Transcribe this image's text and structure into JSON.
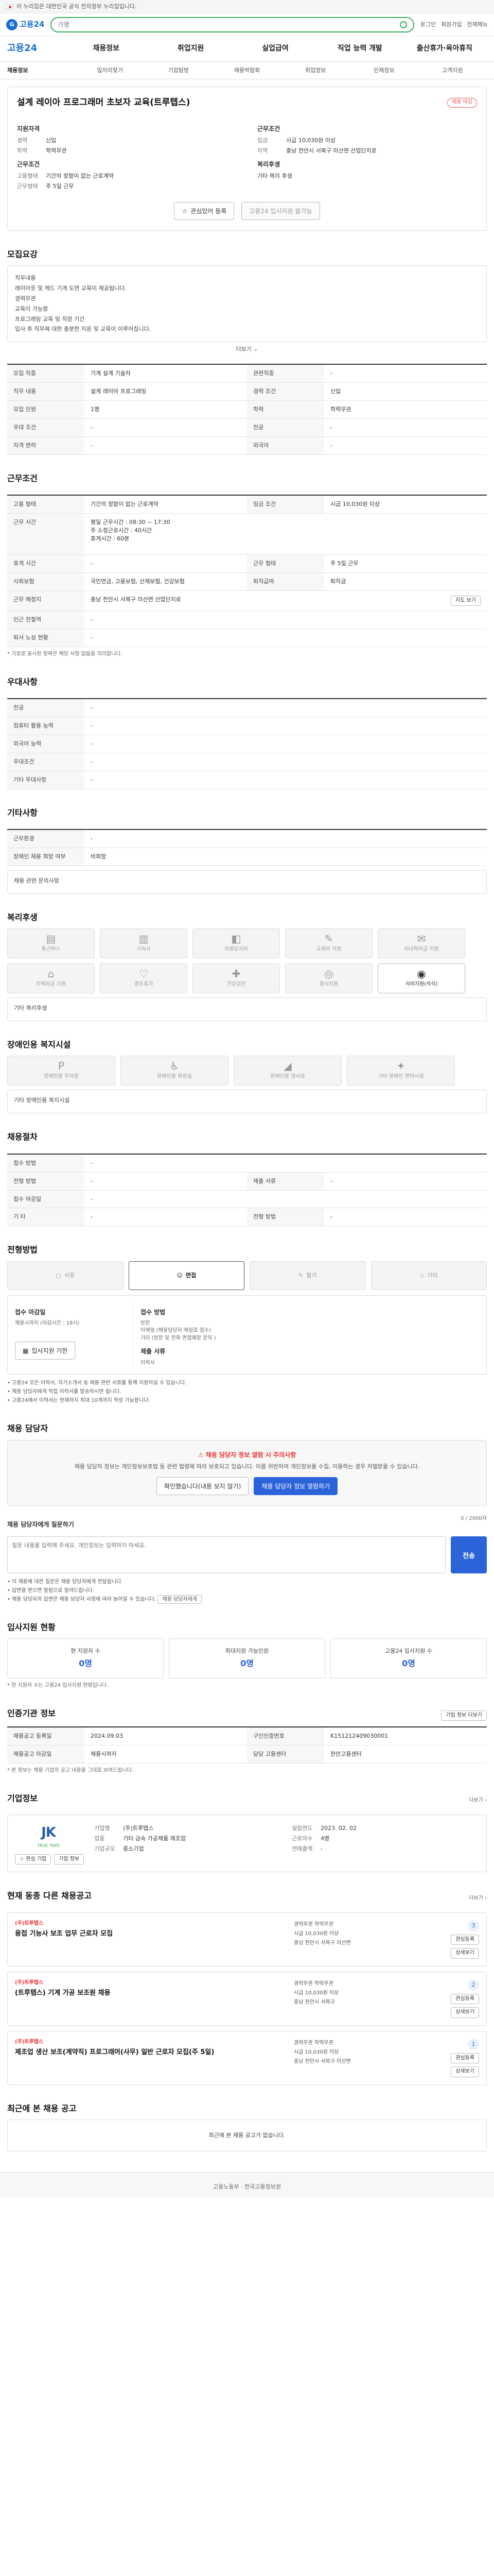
{
  "banner": {
    "text": "이 누리집은 대한민국 공식 전자정부 누리집입니다."
  },
  "topbar": {
    "logo": "고용24",
    "search_placeholder": "가맹",
    "links": [
      "로그인",
      "회원가입",
      "전체메뉴"
    ]
  },
  "gnb": {
    "brand": "고용24",
    "items": [
      "채용정보",
      "취업지원",
      "실업급여",
      "직업 능력 개발",
      "출산휴가·육아휴직"
    ]
  },
  "subnav": {
    "items": [
      "채용정보",
      "일자리찾기",
      "기업탐방",
      "채용박람회",
      "취업정보",
      "인재정보",
      "고객지원"
    ]
  },
  "job": {
    "title": "설계 레이아 프로그래머 초보자 교육(트루텝스)",
    "status": "채용 마감",
    "company_block": "지원자격",
    "left": [
      {
        "k": "경력",
        "v": "신입"
      },
      {
        "k": "학력",
        "v": "학력무관"
      }
    ],
    "left_title2": "근무조건",
    "left2": [
      {
        "k": "고용형태",
        "v": "기간의 정함이 없는 근로계약"
      },
      {
        "k": "근무형태",
        "v": "주 5일 근무"
      }
    ],
    "right_title": "근무조건",
    "right": [
      {
        "k": "임금",
        "v": "시급 10,030원 이상"
      },
      {
        "k": "지역",
        "v": "충남 천안시 서북구 미산면 산업단지로"
      }
    ],
    "right_title2": "복리후생",
    "right2": [
      {
        "k": "",
        "v": "기타 복리 후생"
      }
    ],
    "btn_scrap": "관심있어 등록",
    "btn_apply": "고용24 입사지원 불가능"
  },
  "sections": {
    "desc_title": "모집요강",
    "desc_lines": [
      "직무내용",
      "레이아웃 및 캐드 기계 도면 교육이 제공됩니다.",
      "경력무관",
      "교육이 가능함",
      "프로그래밍 교육 및 직장 기간",
      "입사 후 직무에 대한 충분한 지원 및 교육이 이루어집니다."
    ],
    "desc_more": "더보기",
    "rec_rows": [
      [
        {
          "k": "모집 직종",
          "v": "기계 설계 기술자"
        },
        {
          "k": "관련직종",
          "v": "-"
        }
      ],
      [
        {
          "k": "직무 내용",
          "v": "설계 레이아 프로그래밍"
        },
        {
          "k": "경력 조건",
          "v": "신입"
        }
      ],
      [
        {
          "k": "모집 인원",
          "v": "1명"
        },
        {
          "k": "학력",
          "v": "학력무관"
        }
      ],
      [
        {
          "k": "우대 조건",
          "v": "-"
        },
        {
          "k": "전공",
          "v": "-"
        }
      ],
      [
        {
          "k": "자격 면허",
          "v": "-"
        },
        {
          "k": "외국어",
          "v": "-"
        }
      ]
    ],
    "cond_title": "근무조건",
    "cond_rows": [
      [
        {
          "k": "고용 형태",
          "v": "기간의 정함이 없는 근로계약"
        },
        {
          "k": "임금 조건",
          "v": "시급 10,030원 이상"
        }
      ],
      [
        {
          "k": "근무 시간",
          "v": "평일 근무시간 : 08:30 ~ 17:30\n주 소정근로시간 : 40시간\n휴게시간 : 60분"
        },
        {
          "k": "",
          "v": ""
        }
      ],
      [
        {
          "k": "휴게 시간",
          "v": "-"
        },
        {
          "k": "근무 형태",
          "v": "주 5일 근무"
        }
      ],
      [
        {
          "k": "사회보험",
          "v": "국민연금, 고용보험, 산재보험, 건강보험"
        },
        {
          "k": "퇴직급여",
          "v": "퇴직금"
        }
      ],
      [
        {
          "k": "근무 예정지",
          "v": "충남 천안시 서북구 미산면 산업단지로 "
        },
        {
          "k": "",
          "v": ""
        }
      ],
      [
        {
          "k": "인근 전철역",
          "v": "-"
        },
        {
          "k": "",
          "v": ""
        }
      ],
      [
        {
          "k": "퇴사 노성 현황",
          "v": "-"
        },
        {
          "k": "",
          "v": ""
        }
      ]
    ],
    "cond_map": "지도 보기",
    "cond_note": "* 기호로 표시된 항목은 해당 사항 없음을 의미합니다.",
    "extra_title": "우대사항",
    "extra_rows": [
      [
        {
          "k": "전공",
          "v": "-"
        }
      ],
      [
        {
          "k": "컴퓨터 활용 능력",
          "v": "-"
        }
      ],
      [
        {
          "k": "외국어 능력",
          "v": "-"
        }
      ],
      [
        {
          "k": "우대조건",
          "v": "-"
        }
      ],
      [
        {
          "k": "기타 우대사항",
          "v": "-"
        }
      ]
    ],
    "env_title": "기타사항",
    "env_rows": [
      [
        {
          "k": "근무환경",
          "v": "-"
        }
      ],
      [
        {
          "k": "장애인 채용 희망 여부",
          "v": "비희망"
        }
      ]
    ],
    "env_box": "채용 관련 문의사항",
    "welfare_title": "복리후생",
    "welfare_icons": [
      {
        "label": "통근버스",
        "glyph": "▤",
        "on": false
      },
      {
        "label": "기숙사",
        "glyph": "▥",
        "on": false
      },
      {
        "label": "차량유지비",
        "glyph": "◧",
        "on": false
      },
      {
        "label": "교육비 지원",
        "glyph": "✎",
        "on": false
      },
      {
        "label": "자녀학자금 지원",
        "glyph": "✉",
        "on": false
      },
      {
        "label": "주택자금 지원",
        "glyph": "⌂",
        "on": false
      },
      {
        "label": "경조휴가",
        "glyph": "♡",
        "on": false
      },
      {
        "label": "건강검진",
        "glyph": "✚",
        "on": false
      },
      {
        "label": "중식지원",
        "glyph": "◎",
        "on": false
      },
      {
        "label": "식비지원(석식)",
        "glyph": "◉",
        "on": true
      }
    ],
    "welfare_box": "기타 복리후생",
    "disab_title": "장애인용 복지시설",
    "disab_icons": [
      {
        "label": "장애인용 주차장",
        "glyph": "P",
        "on": false
      },
      {
        "label": "장애인용 화장실",
        "glyph": "♿",
        "on": false
      },
      {
        "label": "장애인용 경사로",
        "glyph": "◢",
        "on": false
      },
      {
        "label": "기타 장애인 편의시설",
        "glyph": "✦",
        "on": false
      }
    ],
    "disab_box": "기타 장애인용 복지시설",
    "process_title": "채용절차",
    "process_rows": [
      [
        {
          "k": "접수 방법",
          "v": "-"
        },
        {
          "k": "",
          "v": ""
        }
      ],
      [
        {
          "k": "전형 방법",
          "v": "-"
        },
        {
          "k": "제출 서류",
          "v": "-"
        }
      ],
      [
        {
          "k": "접수 마감일",
          "v": "-"
        },
        {
          "k": "",
          "v": ""
        }
      ],
      [
        {
          "k": "기 타",
          "v": "-"
        },
        {
          "k": "전형 방법",
          "v": "-"
        }
      ]
    ],
    "method_title": "전형방법",
    "method_tabs": [
      {
        "label": "서류",
        "glyph": "▢",
        "on": false
      },
      {
        "label": "면접",
        "glyph": "☺",
        "on": true
      },
      {
        "label": "필기",
        "glyph": "✎",
        "on": false
      },
      {
        "label": "기타",
        "glyph": "◇",
        "on": false
      }
    ],
    "apply_left_title": "접수 마감일",
    "apply_left_value": "채용시까지 (마감시간 : 18시)",
    "apply_left_btn": "입사지원 기한",
    "apply_right_title": "접수 방법",
    "apply_right_lines": [
      "방문",
      "이메일 (채용담당자 메일로 접수)",
      "기타 (방문 및 전화 면접예정 문의 )"
    ],
    "apply_right_title2": "제출 서류",
    "apply_right_value2": "이력서",
    "apply_bullets": [
      "• 고용24 모든 이력서, 자기소개서 등 채용 관련 서류를 통해 지원하실 수 있습니다.",
      "• 채용 담당자에게 직접 이력서를 발송하시면 됩니다.",
      "• 고용24에서 이력서는 현재까지 최대 10개까지 작성 가능합니다."
    ],
    "contact_title": "채용 담당자",
    "contact_notice_title": "채용 담당자 정보 열람 시 주의사항",
    "contact_notice_text": "채용 담당자 정보는 개인정보보호법 등 관련 법령에 따라 보호되고 있습니다. 이를 위반하여 개인정보를 수집, 이용하는 경우 처벌받을 수 있습니다.",
    "contact_btn1": "확인했습니다(내용 보지 않기)",
    "contact_btn2": "채용 담당자 정보 열람하기",
    "ask_title": "채용 담당자에게 질문하기",
    "ask_count": "0 / 2000자",
    "ask_placeholder": "질문 내용을 입력해 주세요. 개인정보는 입력하지 마세요.",
    "ask_btn": "전송",
    "ask_notes": [
      "• 이 채용에 대한 질문은 채용 담당자에게 전달됩니다.",
      "• 답변을 받으면 알림으로 알려드립니다.",
      "• 채용 담당자의 답변은 채용 담당자 사정에 따라 늦어질 수 있습니다."
    ],
    "ask_link": "채용 담당자에게",
    "stats_title": "입사지원 현황",
    "stats": [
      {
        "label": "현 지원자 수",
        "value": "0명"
      },
      {
        "label": "최대지원 가능인원",
        "value": "0명"
      },
      {
        "label": "고용24 입사지원 수",
        "value": "0명"
      }
    ],
    "stats_note": "* 현 지원자 수는 고용24 입사지원 현황입니다.",
    "info_title": "인증기관 정보",
    "info_btn": "기업 정보 더보기",
    "info_rows": [
      [
        {
          "k": "채용공고 등록일",
          "v": "2024.09.03"
        },
        {
          "k": "구인인증번호",
          "v": "K151212409030001"
        }
      ],
      [
        {
          "k": "채용공고 마감일",
          "v": "채용시까지"
        },
        {
          "k": "담당 고용센터",
          "v": "천안고용센터"
        }
      ]
    ],
    "info_note": "* 본 정보는 채용 기업의 공고 내용을 그대로 보여드립니다.",
    "company_title": "기업정보",
    "company_more": "더보기",
    "company_logo_main": "JK",
    "company_logo_sub": "TRUE TEPS",
    "company_btn1": "관심 기업",
    "company_btn2": "기업 정보",
    "company_cols": [
      [
        {
          "k": "기업명",
          "v": "(주)트루텝스"
        },
        {
          "k": "업종",
          "v": "기타 금속 가공제품 제조업"
        },
        {
          "k": "기업규모",
          "v": "중소기업"
        }
      ],
      [
        {
          "k": "설립연도",
          "v": "2023. 02. 02"
        },
        {
          "k": "근로자수",
          "v": "4명"
        },
        {
          "k": "연매출액",
          "v": "-"
        }
      ]
    ],
    "similar_title": "현재 동종 다른 채용공고",
    "similar_more": "더보기",
    "similar": [
      {
        "company": "(주)트루텝스",
        "title": "용접 기능사 보조 업무 근로자 모집",
        "meta": [
          "경력무관  학력무관",
          "시급 10,030원 이상",
          "충남 천안시 서북구 미산면"
        ],
        "n": "3"
      },
      {
        "company": "(주)트루텝스",
        "title": "(트루텝스) 기계 가공 보조원 채용",
        "meta": [
          "경력무관  학력무관",
          "시급 10,030원 이상",
          "충남 천안시 서북구"
        ],
        "n": "2"
      },
      {
        "company": "(주)트루텝스",
        "title": "제조업 생산 보조(계약직) 프로그래머(사무) 일반 근로자 모집(주 5일)",
        "meta": [
          "경력무관  학력무관",
          "시급 10,030원 이상",
          "충남 천안시 서북구 미산면"
        ],
        "n": "1"
      }
    ],
    "similar_ops": [
      "관심등록",
      "상세보기"
    ],
    "recent_title": "최근에 본 채용 공고",
    "recent_empty": "최근에 본 채용 공고가 없습니다."
  },
  "footer": {
    "text": "고용노동부 · 한국고용정보원"
  }
}
